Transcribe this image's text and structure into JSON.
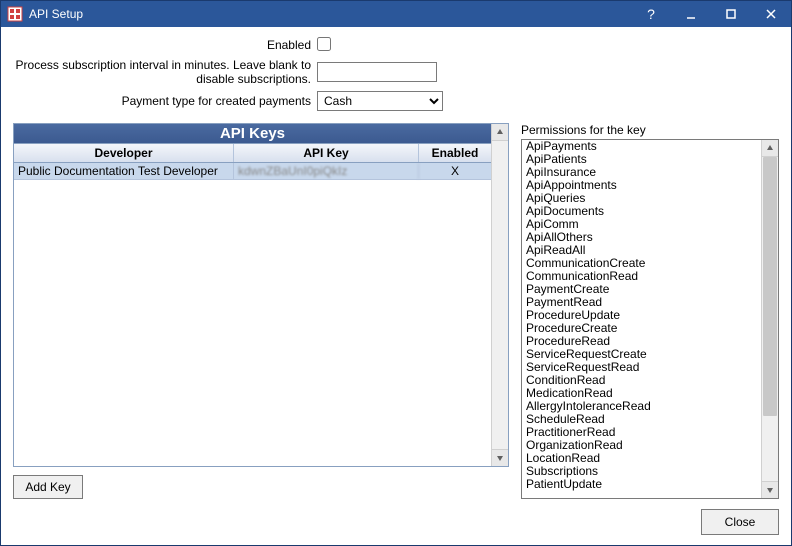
{
  "window": {
    "title": "API Setup"
  },
  "form": {
    "enabled_label": "Enabled",
    "enabled_checked": false,
    "interval_label": "Process subscription interval in minutes. Leave blank to disable subscriptions.",
    "interval_value": "",
    "paytype_label": "Payment type for created payments",
    "paytype_value": "Cash"
  },
  "grid": {
    "title": "API Keys",
    "cols": {
      "developer": "Developer",
      "apikey": "API Key",
      "enabled": "Enabled"
    },
    "rows": [
      {
        "developer": "Public Documentation Test Developer",
        "apikey": "kdwnZBaUnI0piQkIz",
        "enabled": "X"
      }
    ]
  },
  "permissions": {
    "label": "Permissions for the key",
    "items": [
      "ApiPayments",
      "ApiPatients",
      "ApiInsurance",
      "ApiAppointments",
      "ApiQueries",
      "ApiDocuments",
      "ApiComm",
      "ApiAllOthers",
      "ApiReadAll",
      "CommunicationCreate",
      "CommunicationRead",
      "PaymentCreate",
      "PaymentRead",
      "ProcedureUpdate",
      "ProcedureCreate",
      "ProcedureRead",
      "ServiceRequestCreate",
      "ServiceRequestRead",
      "ConditionRead",
      "MedicationRead",
      "AllergyIntoleranceRead",
      "ScheduleRead",
      "PractitionerRead",
      "OrganizationRead",
      "LocationRead",
      "Subscriptions",
      "PatientUpdate"
    ]
  },
  "buttons": {
    "add_key": "Add Key",
    "close": "Close"
  }
}
